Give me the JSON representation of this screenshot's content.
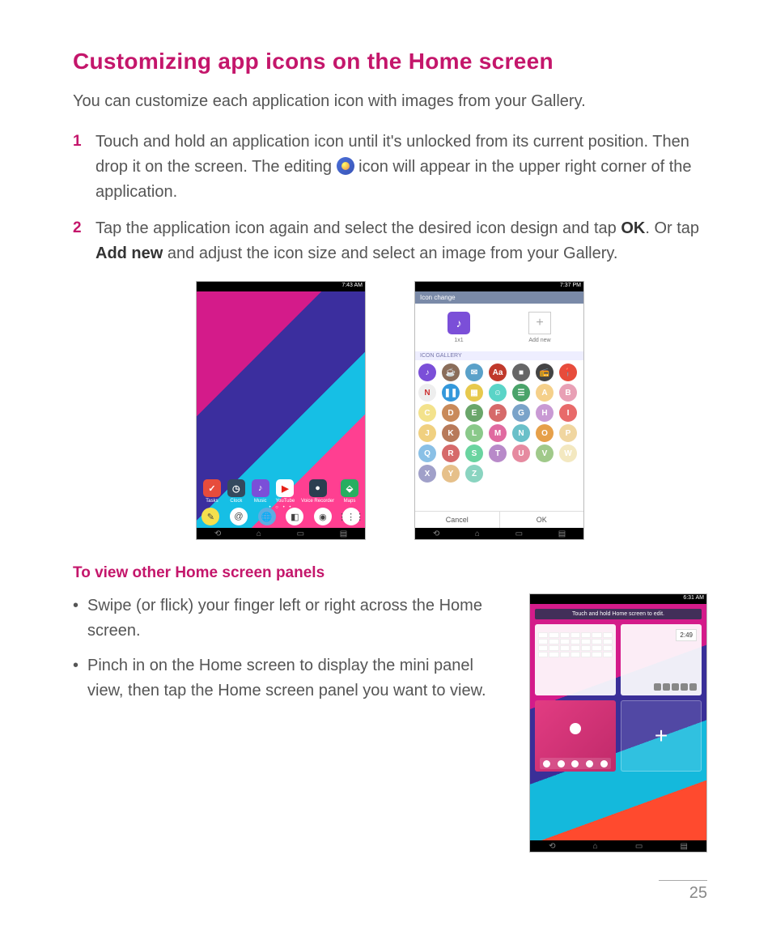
{
  "heading": "Customizing app icons on the Home screen",
  "intro": "You can customize each application icon with images from your Gallery.",
  "steps": [
    {
      "num": "1",
      "pre": "Touch and hold an application icon until it's unlocked from its current position. Then drop it on the screen. The editing ",
      "post": " icon will appear in the upper right corner of the application."
    },
    {
      "num": "2",
      "pre": "Tap the application icon again and select the desired icon design and tap ",
      "b1": "OK",
      "mid": ". Or tap ",
      "b2": "Add new",
      "post": " and adjust the icon size and select an image from your Gallery."
    }
  ],
  "phone1": {
    "time": "7:43 AM",
    "dock": [
      {
        "label": "Tasks",
        "glyph": "✓",
        "bg": "#e74c3c"
      },
      {
        "label": "Clock",
        "glyph": "◷",
        "bg": "#34495e"
      },
      {
        "label": "Music",
        "glyph": "♪",
        "bg": "#7b4fd8"
      },
      {
        "label": "YouTube",
        "glyph": "▶",
        "bg": "#fff",
        "fg": "#e62117"
      },
      {
        "label": "Voice Recorder",
        "glyph": "●",
        "bg": "#2c3e50"
      },
      {
        "label": "Maps",
        "glyph": "⬙",
        "bg": "#27ae60"
      }
    ],
    "tray": [
      {
        "glyph": "✎",
        "bg": "#f4e04d"
      },
      {
        "glyph": "@",
        "bg": "#fff"
      },
      {
        "glyph": "🌐",
        "bg": "#5dade2"
      },
      {
        "glyph": "◧",
        "bg": "#fff"
      },
      {
        "glyph": "◉",
        "bg": "#fff"
      },
      {
        "glyph": "⋮⋮⋮",
        "bg": "#fff"
      }
    ]
  },
  "phone2": {
    "time": "7:37 PM",
    "header": "Icon change",
    "leftLabel": "1x1",
    "rightLabel": "Add new",
    "galleryHead": "ICON GALLERY",
    "icons": [
      {
        "t": "♪",
        "c": "#7b4fd8"
      },
      {
        "t": "☕",
        "c": "#8a6d5a"
      },
      {
        "t": "✉",
        "c": "#5aa1c9"
      },
      {
        "t": "Aa",
        "c": "#c0392b"
      },
      {
        "t": "■",
        "c": "#666"
      },
      {
        "t": "📻",
        "c": "#444"
      },
      {
        "t": "📍",
        "c": "#e74c3c"
      },
      {
        "t": "N",
        "c": "#eee",
        "fg": "#c33"
      },
      {
        "t": "❚❚",
        "c": "#3498db"
      },
      {
        "t": "▦",
        "c": "#e7c94d"
      },
      {
        "t": "☺",
        "c": "#5ad4c7"
      },
      {
        "t": "☰",
        "c": "#4aa36a"
      },
      {
        "t": "A",
        "c": "#f5d08a"
      },
      {
        "t": "B",
        "c": "#e8a0b5"
      },
      {
        "t": "C",
        "c": "#f3e28c"
      },
      {
        "t": "D",
        "c": "#c98a5a"
      },
      {
        "t": "E",
        "c": "#6aa66a"
      },
      {
        "t": "F",
        "c": "#d66a6a"
      },
      {
        "t": "G",
        "c": "#7aa3c9"
      },
      {
        "t": "H",
        "c": "#c99ad4"
      },
      {
        "t": "I",
        "c": "#e86a6a"
      },
      {
        "t": "J",
        "c": "#f0d080"
      },
      {
        "t": "K",
        "c": "#b87a5a"
      },
      {
        "t": "L",
        "c": "#8ac98a"
      },
      {
        "t": "M",
        "c": "#e06aa0"
      },
      {
        "t": "N",
        "c": "#6ac0c9"
      },
      {
        "t": "O",
        "c": "#e6a04a"
      },
      {
        "t": "P",
        "c": "#f0d6a0"
      },
      {
        "t": "Q",
        "c": "#8ac0e6"
      },
      {
        "t": "R",
        "c": "#d66a6a"
      },
      {
        "t": "S",
        "c": "#6ad4a0"
      },
      {
        "t": "T",
        "c": "#b88ac9"
      },
      {
        "t": "U",
        "c": "#e68aa0"
      },
      {
        "t": "V",
        "c": "#a0c98a"
      },
      {
        "t": "W",
        "c": "#f3e8c0"
      },
      {
        "t": "X",
        "c": "#a0a0c9"
      },
      {
        "t": "Y",
        "c": "#e6c08a"
      },
      {
        "t": "Z",
        "c": "#8ad4c0"
      }
    ],
    "cancel": "Cancel",
    "ok": "OK"
  },
  "subheading": "To view other Home screen panels",
  "bullets": [
    "Swipe (or flick) your finger left or right across the Home screen.",
    "Pinch in on the Home screen to display the mini panel view, then tap the Home screen panel you want to view."
  ],
  "phone3": {
    "time": "6:31 AM",
    "hint": "Touch and hold Home screen to edit.",
    "clock": "2:49"
  },
  "pageNumber": "25"
}
